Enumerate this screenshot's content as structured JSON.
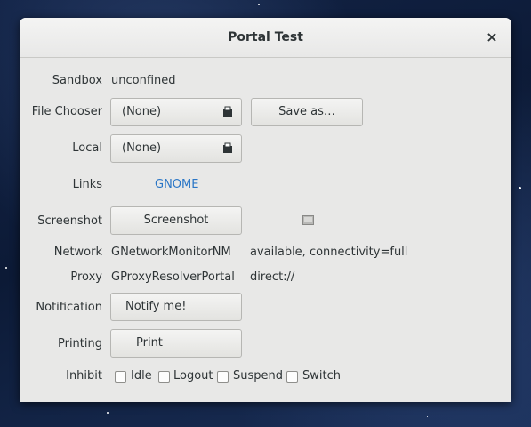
{
  "window": {
    "title": "Portal Test"
  },
  "labels": {
    "sandbox": "Sandbox",
    "file_chooser": "File Chooser",
    "local": "Local",
    "links": "Links",
    "screenshot": "Screenshot",
    "network": "Network",
    "proxy": "Proxy",
    "notification": "Notification",
    "printing": "Printing",
    "inhibit": "Inhibit"
  },
  "values": {
    "sandbox": "unconfined",
    "file_chooser": "(None)",
    "save_as": "Save as…",
    "local": "(None)",
    "link": "GNOME",
    "screenshot_button": "Screenshot",
    "network_monitor": "GNetworkMonitorNM",
    "network_status": "available, connectivity=full",
    "proxy_resolver": "GProxyResolverPortal",
    "proxy_value": "direct://",
    "notify_button": "Notify me!",
    "print_button": "Print"
  },
  "inhibit": [
    {
      "label": "Idle",
      "checked": false
    },
    {
      "label": "Logout",
      "checked": false
    },
    {
      "label": "Suspend",
      "checked": false
    },
    {
      "label": "Switch",
      "checked": false
    }
  ],
  "icons": {
    "close": "close-icon",
    "file_chooser": "document-open-icon",
    "local": "document-open-icon",
    "screenshot_preview": "image-icon"
  }
}
